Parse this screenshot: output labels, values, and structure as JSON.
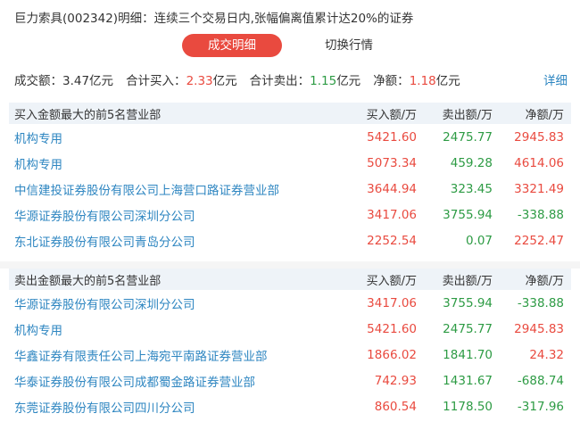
{
  "title": "巨力索具(002342)明细：连续三个交易日内,张幅偏离值累计达20%的证券",
  "tabs": {
    "active": "成交明细",
    "inactive": "切换行情"
  },
  "summary": {
    "turnover_label": "成交额：",
    "turnover_value": "3.47亿元",
    "buy_label": "合计买入：",
    "buy_value": "2.33",
    "buy_unit": "亿元",
    "sell_label": "合计卖出：",
    "sell_value": "1.15",
    "sell_unit": "亿元",
    "net_label": "净额：",
    "net_value": "1.18",
    "net_unit": "亿元",
    "detail_link": "详细"
  },
  "buy_section": {
    "header": "买入金额最大的前5名营业部",
    "columns": [
      "买入额/万",
      "卖出额/万",
      "净额/万"
    ],
    "rows": [
      {
        "name": "机构专用",
        "buy": "5421.60",
        "sell": "2475.77",
        "net": "2945.83"
      },
      {
        "name": "机构专用",
        "buy": "5073.34",
        "sell": "459.28",
        "net": "4614.06"
      },
      {
        "name": "中信建投证券股份有限公司上海营口路证券营业部",
        "buy": "3644.94",
        "sell": "323.45",
        "net": "3321.49"
      },
      {
        "name": "华源证券股份有限公司深圳分公司",
        "buy": "3417.06",
        "sell": "3755.94",
        "net": "-338.88"
      },
      {
        "name": "东北证券股份有限公司青岛分公司",
        "buy": "2252.54",
        "sell": "0.07",
        "net": "2252.47"
      }
    ]
  },
  "sell_section": {
    "header": "卖出金额最大的前5名营业部",
    "columns": [
      "买入额/万",
      "卖出额/万",
      "净额/万"
    ],
    "rows": [
      {
        "name": "华源证券股份有限公司深圳分公司",
        "buy": "3417.06",
        "sell": "3755.94",
        "net": "-338.88"
      },
      {
        "name": "机构专用",
        "buy": "5421.60",
        "sell": "2475.77",
        "net": "2945.83"
      },
      {
        "name": "华鑫证券有限责任公司上海宛平南路证券营业部",
        "buy": "1866.02",
        "sell": "1841.70",
        "net": "24.32"
      },
      {
        "name": "华泰证券股份有限公司成都蜀金路证券营业部",
        "buy": "742.93",
        "sell": "1431.67",
        "net": "-688.74"
      },
      {
        "name": "东莞证券股份有限公司四川分公司",
        "buy": "860.54",
        "sell": "1178.50",
        "net": "-317.96"
      }
    ]
  },
  "colors": {
    "accent": "#e94a3f",
    "up": "#e94a3f",
    "down": "#2d9b44",
    "link": "#2e86c1",
    "header_bg": "#eef3f8"
  }
}
